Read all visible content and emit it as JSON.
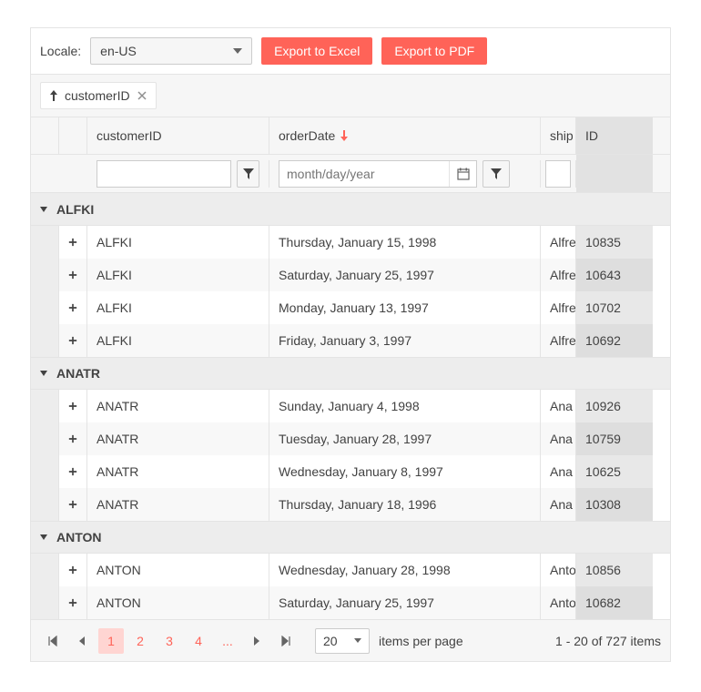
{
  "topbar": {
    "locale_label": "Locale:",
    "locale_value": "en-US",
    "export_excel": "Export to Excel",
    "export_pdf": "Export to PDF"
  },
  "group_chip": {
    "field": "customerID"
  },
  "columns": {
    "customerID": "customerID",
    "orderDate": "orderDate",
    "shipName": "ship",
    "id": "ID"
  },
  "filters": {
    "date_placeholder": "month/day/year"
  },
  "groups": [
    {
      "name": "ALFKI",
      "rows": [
        {
          "customerID": "ALFKI",
          "orderDate": "Thursday, January 15, 1998",
          "shipName": "Alfre",
          "id": "10835"
        },
        {
          "customerID": "ALFKI",
          "orderDate": "Saturday, January 25, 1997",
          "shipName": "Alfre",
          "id": "10643"
        },
        {
          "customerID": "ALFKI",
          "orderDate": "Monday, January 13, 1997",
          "shipName": "Alfre",
          "id": "10702"
        },
        {
          "customerID": "ALFKI",
          "orderDate": "Friday, January 3, 1997",
          "shipName": "Alfre",
          "id": "10692"
        }
      ]
    },
    {
      "name": "ANATR",
      "rows": [
        {
          "customerID": "ANATR",
          "orderDate": "Sunday, January 4, 1998",
          "shipName": "Ana",
          "id": "10926"
        },
        {
          "customerID": "ANATR",
          "orderDate": "Tuesday, January 28, 1997",
          "shipName": "Ana",
          "id": "10759"
        },
        {
          "customerID": "ANATR",
          "orderDate": "Wednesday, January 8, 1997",
          "shipName": "Ana",
          "id": "10625"
        },
        {
          "customerID": "ANATR",
          "orderDate": "Thursday, January 18, 1996",
          "shipName": "Ana",
          "id": "10308"
        }
      ]
    },
    {
      "name": "ANTON",
      "rows": [
        {
          "customerID": "ANTON",
          "orderDate": "Wednesday, January 28, 1998",
          "shipName": "Anto",
          "id": "10856"
        },
        {
          "customerID": "ANTON",
          "orderDate": "Saturday, January 25, 1997",
          "shipName": "Anto",
          "id": "10682"
        }
      ]
    }
  ],
  "pager": {
    "pages": [
      "1",
      "2",
      "3",
      "4"
    ],
    "dots": "...",
    "size": "20",
    "size_label": "items per page",
    "info": "1 - 20 of 727 items"
  }
}
